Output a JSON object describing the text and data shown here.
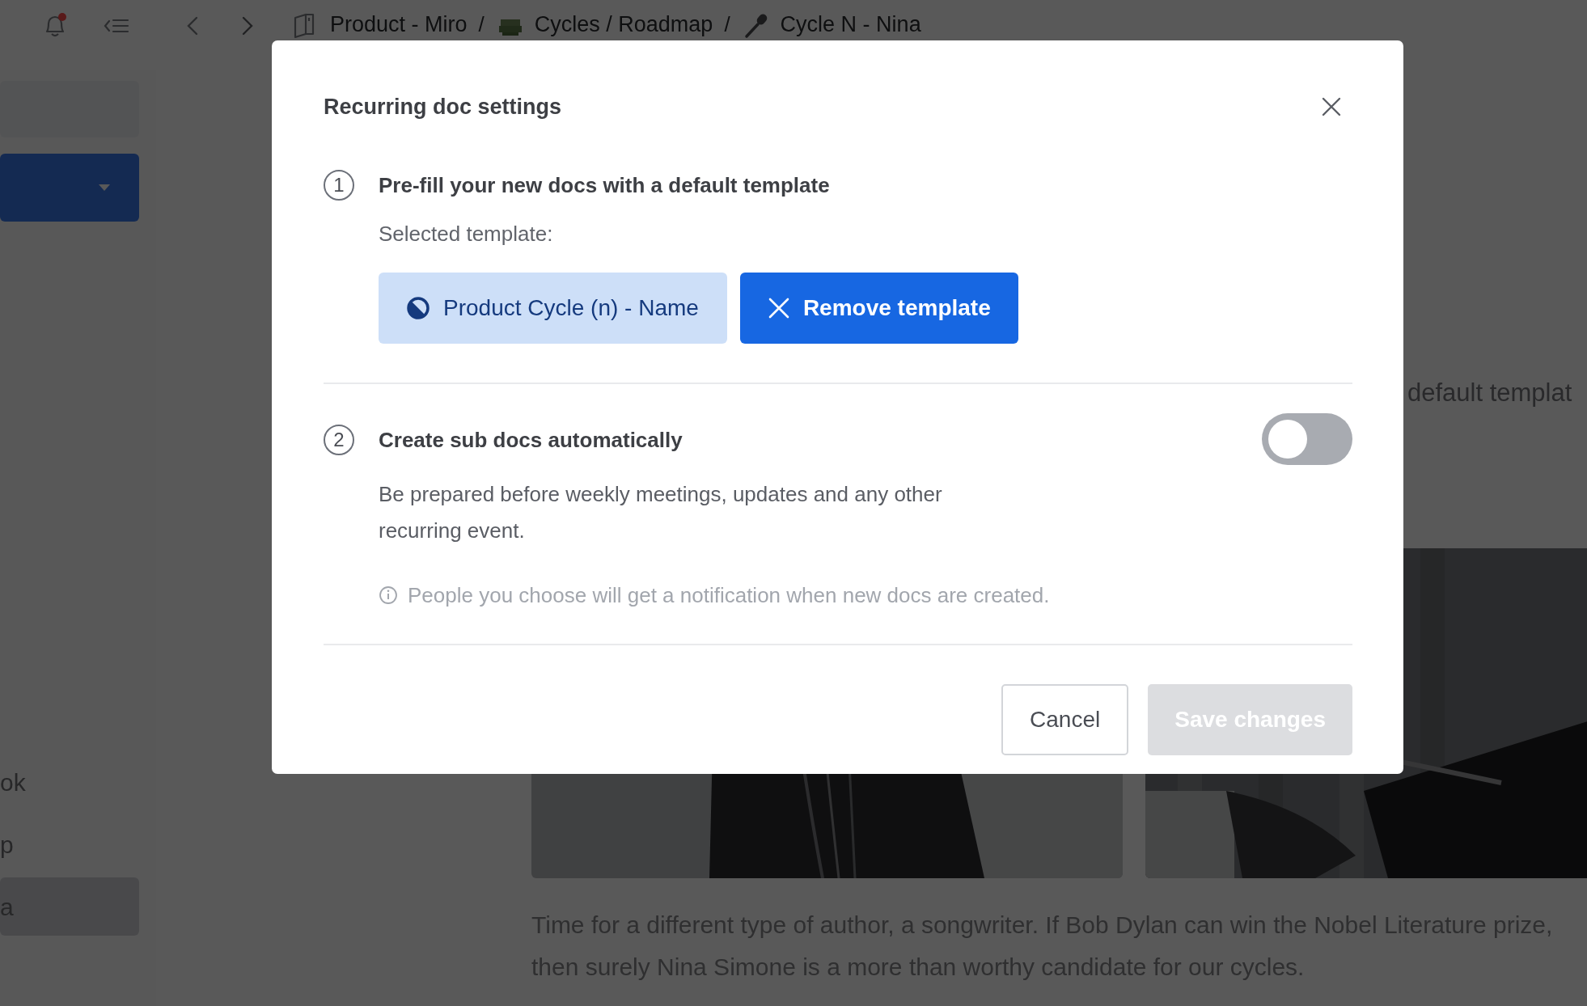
{
  "topbar": {
    "notifications": {
      "unread": true
    },
    "separator": "/",
    "breadcrumb": [
      {
        "label": "Product - Miro"
      },
      {
        "label": "Cycles / Roadmap"
      },
      {
        "label": "Cycle N - Nina"
      }
    ]
  },
  "sidebar": {
    "items": [
      {
        "label": "ok",
        "selected": false
      },
      {
        "label": "p",
        "selected": false
      },
      {
        "label": "a",
        "selected": true
      }
    ]
  },
  "document": {
    "heading_fragment": "default templat",
    "paragraph": "Time for a different type of author, a songwriter. If Bob Dylan can win the Nobel Literature prize, then surely Nina Simone is a more than worthy candidate for our cycles."
  },
  "modal": {
    "title": "Recurring doc settings",
    "steps": [
      {
        "number": "1",
        "title": "Pre-fill your new docs with a default template",
        "label": "Selected template:",
        "template": "Product Cycle (n) - Name",
        "remove_button": "Remove template"
      },
      {
        "number": "2",
        "title": "Create sub docs automatically",
        "description": "Be prepared before weekly meetings, updates and any other recurring event.",
        "toggle": {
          "on": false
        },
        "note": "People you choose will get a notification when new docs are created."
      }
    ],
    "buttons": [
      {
        "label": "Cancel",
        "kind": "secondary"
      },
      {
        "label": "Save changes",
        "kind": "primary",
        "disabled": true
      }
    ]
  }
}
